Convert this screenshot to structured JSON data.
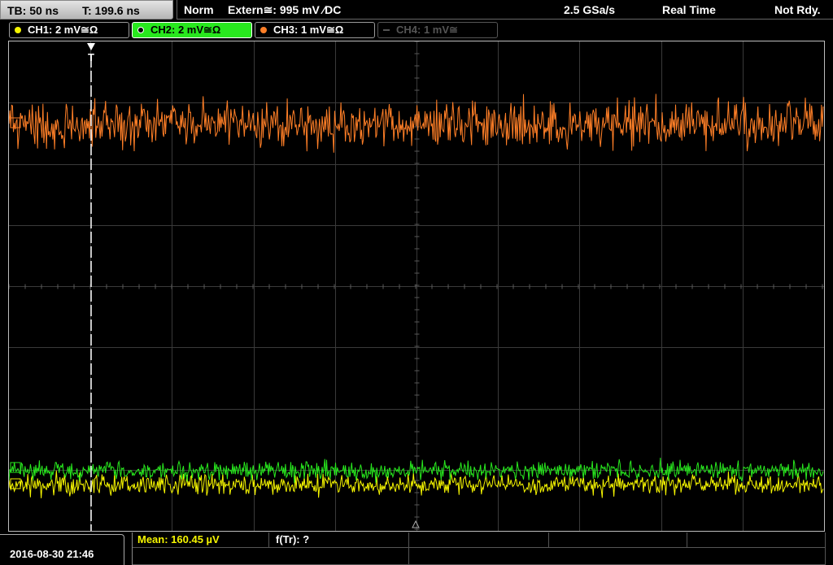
{
  "header": {
    "timebase": "TB: 50 ns",
    "trigger_time": "T: 199.6 ns",
    "mode": "Norm",
    "trigger": "Extern≅: 995 mV ∕DC",
    "sample_rate": "2.5 GSa/s",
    "acq_mode": "Real Time",
    "status": "Not Rdy."
  },
  "channels": [
    {
      "label": "CH1: 2 mV≅Ω",
      "color": "#f5f500",
      "state": "on"
    },
    {
      "label": "CH2: 2 mV≅Ω",
      "color": "#28e81e",
      "state": "active"
    },
    {
      "label": "CH3: 1 mV≅Ω",
      "color": "#ff7f27",
      "state": "on"
    },
    {
      "label": "CH4: 1 mV≅",
      "color": "#555555",
      "state": "off"
    }
  ],
  "trigger_marker": "T",
  "footer": {
    "datetime": "2016-08-30 21:46",
    "mean_label": "Mean: 160.45 µV",
    "ftr_label": "f(Tr): ?"
  },
  "colors": {
    "ch1": "#f5f500",
    "ch2": "#28e81e",
    "ch3": "#ff7f27",
    "grid": "#3a3a3a"
  }
}
